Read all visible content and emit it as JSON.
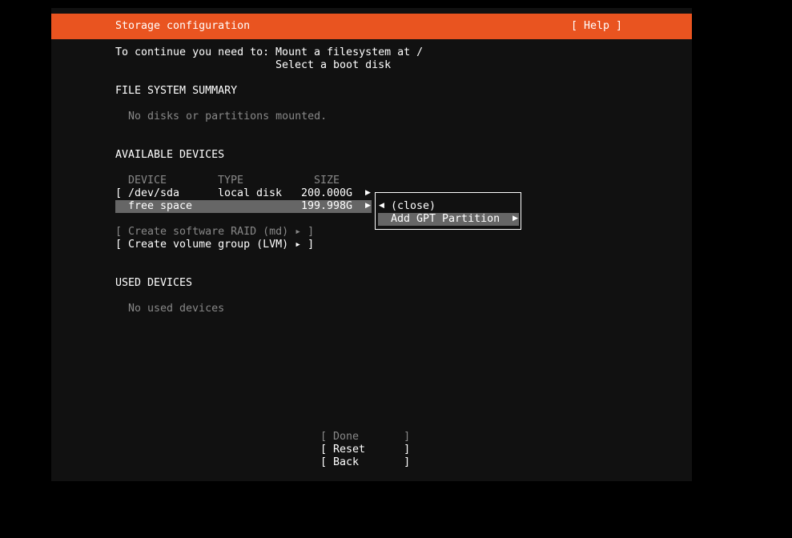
{
  "header": {
    "title": "Storage configuration",
    "help": "[ Help ]",
    "color": "#e95420"
  },
  "instructions": {
    "lead": "To continue you need to:",
    "items": [
      "Mount a filesystem at /",
      "Select a boot disk"
    ]
  },
  "fs_summary": {
    "heading": "FILE SYSTEM SUMMARY",
    "empty": "No disks or partitions mounted."
  },
  "available": {
    "heading": "AVAILABLE DEVICES",
    "columns": {
      "device": "DEVICE",
      "type": "TYPE",
      "size": "SIZE"
    },
    "rows": [
      {
        "bracket": "[",
        "device": "/dev/sda",
        "type": "local disk",
        "size": "200.000G",
        "arrow_icon": "right-triangle-icon"
      },
      {
        "device": "free space",
        "size": "199.998G",
        "selected": true,
        "arrow_icon": "right-triangle-icon"
      }
    ],
    "raid_button": "[ Create software RAID (md) ▸ ]",
    "lvm_button": "[ Create volume group (LVM) ▸ ]"
  },
  "context_menu": {
    "close": "(close)",
    "add_gpt": "Add GPT Partition"
  },
  "used": {
    "heading": "USED DEVICES",
    "empty": "No used devices"
  },
  "footer": {
    "done": "[ Done       ]",
    "reset": "[ Reset      ]",
    "back": "[ Back       ]"
  },
  "colors": {
    "background": "#111111",
    "selection": "#666666",
    "disabled_text": "#888888"
  }
}
